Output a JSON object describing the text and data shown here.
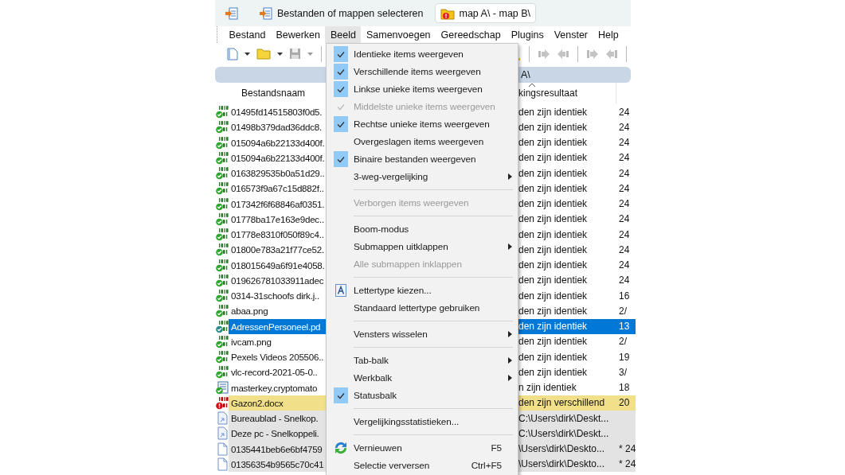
{
  "tabs": [
    {
      "label": "Bestanden of mappen selecteren",
      "selected": false
    },
    {
      "label": "map A\\ - map B\\",
      "selected": true
    }
  ],
  "menubar": [
    {
      "label": "Bestand",
      "selected": false
    },
    {
      "label": "Bewerken",
      "selected": false
    },
    {
      "label": "Beeld",
      "selected": true
    },
    {
      "label": "Samenvoegen",
      "selected": false
    },
    {
      "label": "Gereedschap",
      "selected": false
    },
    {
      "label": "Plugins",
      "selected": false
    },
    {
      "label": "Venster",
      "selected": false
    },
    {
      "label": "Help",
      "selected": false
    }
  ],
  "path_header": "A\\",
  "columns": [
    {
      "label": "Bestandsnaam",
      "sorted": false
    },
    {
      "label": "kingsresultaat",
      "sorted": true
    }
  ],
  "rows": [
    {
      "kind": "binary-same",
      "selected": false,
      "name": "01495fd14515803f0d5.",
      "result": "den zijn identiek",
      "date": "24"
    },
    {
      "kind": "binary-same",
      "selected": false,
      "name": "01498b379dad36ddc8.",
      "result": "den zijn identiek",
      "date": "24"
    },
    {
      "kind": "binary-same",
      "selected": false,
      "name": "015094a6b22133d400f.",
      "result": "den zijn identiek",
      "date": "24"
    },
    {
      "kind": "binary-same",
      "selected": false,
      "name": "015094a6b22133d400f.",
      "result": "den zijn identiek",
      "date": "24"
    },
    {
      "kind": "binary-same",
      "selected": false,
      "name": "0163829535b0a51d29..",
      "result": "den zijn identiek",
      "date": "24"
    },
    {
      "kind": "binary-same",
      "selected": false,
      "name": "016573f9a67c15d882f..",
      "result": "den zijn identiek",
      "date": "24"
    },
    {
      "kind": "binary-same",
      "selected": false,
      "name": "017342f6f68846af0351.",
      "result": "den zijn identiek",
      "date": "24"
    },
    {
      "kind": "binary-same",
      "selected": false,
      "name": "01778ba17e163e9dec..",
      "result": "den zijn identiek",
      "date": "24"
    },
    {
      "kind": "binary-same",
      "selected": false,
      "name": "01778e8310f050f89c4..",
      "result": "den zijn identiek",
      "date": "24"
    },
    {
      "kind": "binary-same",
      "selected": false,
      "name": "01800e783a21f77ce52.",
      "result": "den zijn identiek",
      "date": "24"
    },
    {
      "kind": "binary-same",
      "selected": false,
      "name": "018015649a6f91e4058.",
      "result": "den zijn identiek",
      "date": "24"
    },
    {
      "kind": "binary-same",
      "selected": false,
      "name": "019626781033911adec",
      "result": "den zijn identiek",
      "date": "24"
    },
    {
      "kind": "binary-same",
      "selected": false,
      "name": "0314-31schoofs dirk.j..",
      "result": "den zijn identiek",
      "date": "16"
    },
    {
      "kind": "binary-same",
      "selected": false,
      "name": "abaa.png",
      "result": "den zijn identiek",
      "date": "2/"
    },
    {
      "kind": "binary-same",
      "selected": true,
      "name": "AdressenPersoneel.pd",
      "result": "den zijn identiek",
      "date": "13"
    },
    {
      "kind": "binary-same",
      "selected": false,
      "name": "ivcam.png",
      "result": "den zijn identiek",
      "date": "2/"
    },
    {
      "kind": "binary-same",
      "selected": false,
      "name": "Pexels Videos 205506..",
      "result": "den zijn identiek",
      "date": "19"
    },
    {
      "kind": "binary-same",
      "selected": false,
      "name": "vlc-record-2021-05-0..",
      "result": "den zijn identiek",
      "date": "3/"
    },
    {
      "kind": "text-same",
      "selected": false,
      "name": "masterkey.cryptomato",
      "result": "n zijn identiek",
      "date": "18"
    },
    {
      "kind": "binary-different",
      "selected": false,
      "name": "Gazon2.docx",
      "result": "den zijn verschillend",
      "date": "20"
    },
    {
      "kind": "shortcut",
      "selected": false,
      "name": "Bureaublad - Snelkop.",
      "result": "C:\\Users\\dirk\\Deskt..."
    },
    {
      "kind": "shortcut",
      "selected": false,
      "name": "Deze pc - Snelkoppeli.",
      "result": "C:\\Users\\dirk\\Deskt..."
    },
    {
      "kind": "file",
      "selected": false,
      "name": "0135441beb6e6bf4759",
      "result": "\\Users\\dirk\\Deskto...",
      "date": "* 24"
    },
    {
      "kind": "file",
      "selected": false,
      "name": "01356354b9565c70c41",
      "result": "\\Users\\dirk\\Deskto...",
      "date": "* 24"
    }
  ],
  "menu": [
    {
      "kind": "item",
      "label": "Identieke items weergeven",
      "checked": true,
      "disabled": false
    },
    {
      "kind": "item",
      "label": "Verschillende items weergeven",
      "checked": true,
      "disabled": false
    },
    {
      "kind": "item",
      "label": "Linkse unieke items weergeven",
      "checked": true,
      "disabled": false
    },
    {
      "kind": "item",
      "label": "Middelste unieke items weergeven",
      "checked": true,
      "disabled": true
    },
    {
      "kind": "item",
      "label": "Rechtse unieke items weergeven",
      "checked": true,
      "disabled": false
    },
    {
      "kind": "item",
      "label": "Overgeslagen items weergeven",
      "checked": false,
      "disabled": false
    },
    {
      "kind": "item",
      "label": "Binaire bestanden weergeven",
      "checked": true,
      "disabled": false
    },
    {
      "kind": "item",
      "label": "3-weg-vergelijking",
      "checked": false,
      "disabled": false,
      "submenu": true
    },
    {
      "kind": "separator"
    },
    {
      "kind": "item",
      "label": "Verborgen items weergeven",
      "checked": false,
      "disabled": true
    },
    {
      "kind": "separator"
    },
    {
      "kind": "item",
      "label": "Boom-modus",
      "checked": false,
      "disabled": false
    },
    {
      "kind": "item",
      "label": "Submappen uitklappen",
      "checked": false,
      "disabled": false,
      "submenu": true
    },
    {
      "kind": "item",
      "label": "Alle submappen inklappen",
      "checked": false,
      "disabled": true
    },
    {
      "kind": "separator"
    },
    {
      "kind": "font",
      "label": "Lettertype kiezen...",
      "checked": false,
      "disabled": false
    },
    {
      "kind": "item",
      "label": "Standaard lettertype gebruiken",
      "checked": false,
      "disabled": false
    },
    {
      "kind": "separator"
    },
    {
      "kind": "item",
      "label": "Vensters wisselen",
      "checked": false,
      "disabled": false,
      "submenu": true
    },
    {
      "kind": "separator"
    },
    {
      "kind": "item",
      "label": "Tab-balk",
      "checked": false,
      "disabled": false,
      "submenu": true
    },
    {
      "kind": "item",
      "label": "Werkbalk",
      "checked": false,
      "disabled": false,
      "submenu": true
    },
    {
      "kind": "item",
      "label": "Statusbalk",
      "checked": true,
      "disabled": false
    },
    {
      "kind": "separator"
    },
    {
      "kind": "item",
      "label": "Vergelijkingsstatistieken...",
      "checked": false,
      "disabled": false
    },
    {
      "kind": "separator"
    },
    {
      "kind": "refresh",
      "label": "Vernieuwen",
      "checked": false,
      "disabled": false,
      "shortcut": "F5"
    },
    {
      "kind": "item",
      "label": "Selectie verversen",
      "checked": false,
      "disabled": false,
      "shortcut": "Ctrl+F5"
    }
  ]
}
